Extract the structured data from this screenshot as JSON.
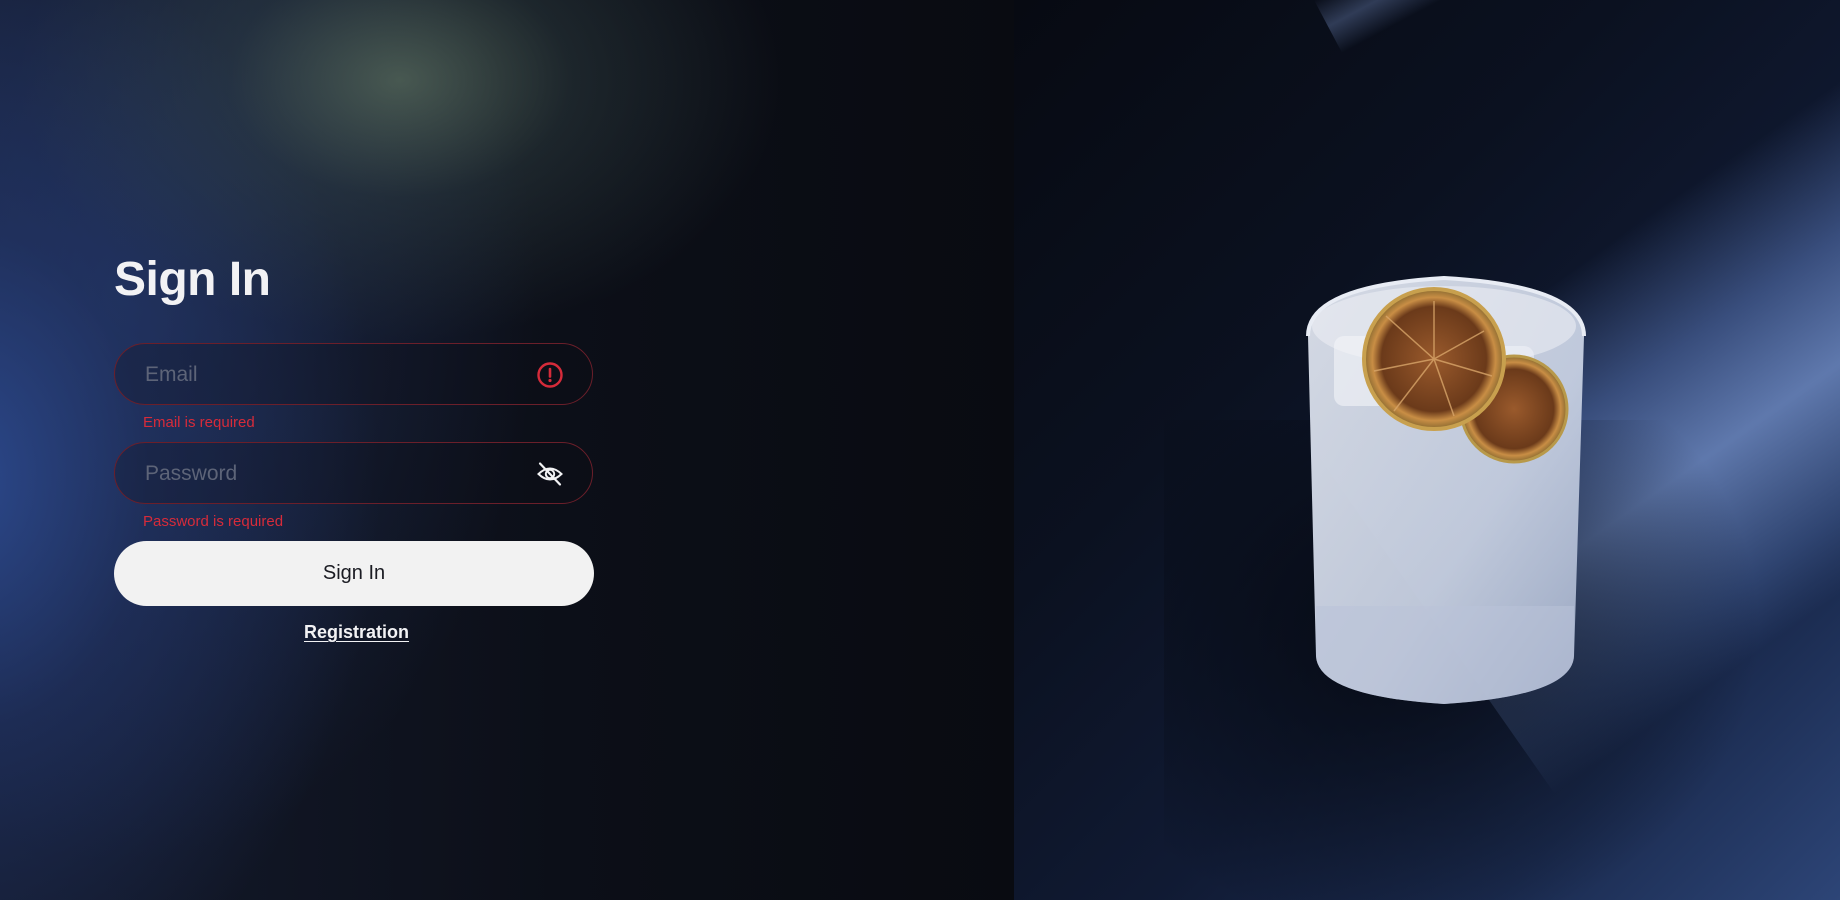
{
  "signin": {
    "title": "Sign In",
    "email": {
      "placeholder": "Email",
      "value": "",
      "error": "Email is required",
      "icon": "alert-circle-icon"
    },
    "password": {
      "placeholder": "Password",
      "value": "",
      "error": "Password is required",
      "icon": "eye-off-icon"
    },
    "submit_label": "Sign In",
    "registration_label": "Registration"
  },
  "colors": {
    "error": "#d62b3a",
    "error_border": "#6b1f2a",
    "button_bg": "#f2f2f2",
    "button_text": "#1a1b22",
    "title": "#f2f2f4",
    "placeholder": "#5d6478"
  },
  "hero_image": {
    "subject": "glass-with-dried-citrus-slices"
  }
}
